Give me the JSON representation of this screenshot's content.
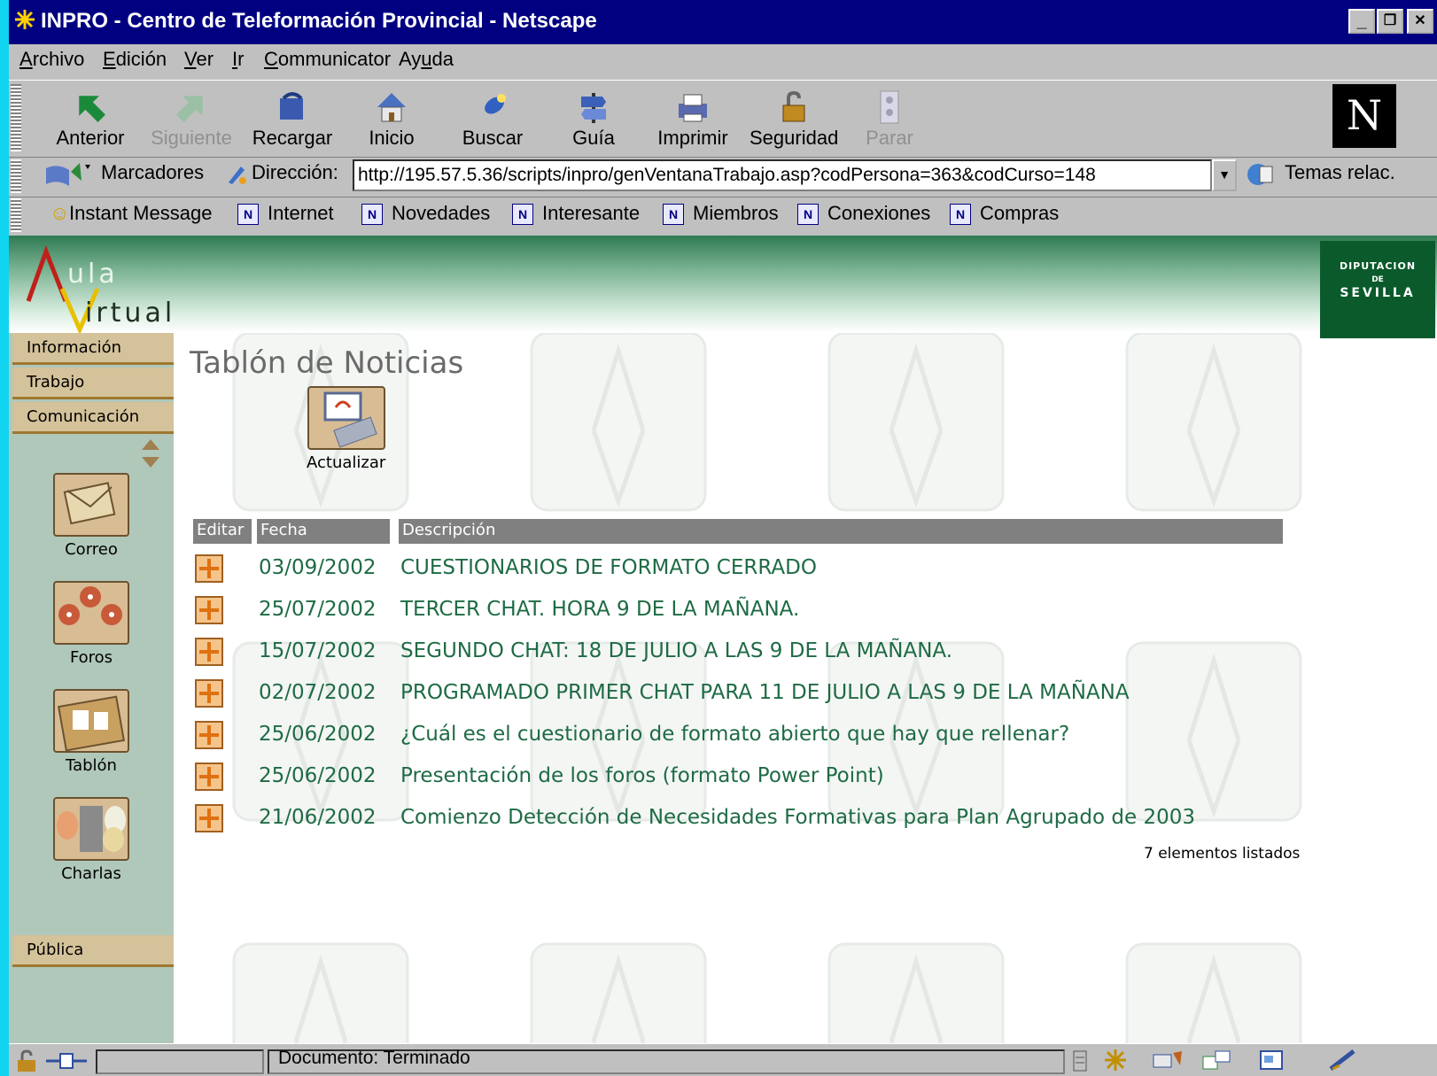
{
  "window": {
    "title": "INPRO - Centro de Teleformación Provincial - Netscape",
    "minimize": "_",
    "maximize": "❐",
    "close": "✕"
  },
  "menu": [
    {
      "first": "A",
      "rest": "rchivo"
    },
    {
      "first": "E",
      "rest": "dición"
    },
    {
      "first": "V",
      "rest": "er"
    },
    {
      "first": "I",
      "rest": "r"
    },
    {
      "first": "C",
      "rest": "ommunicator"
    },
    {
      "first": "Ay",
      "u": "u",
      "rest": "da"
    }
  ],
  "menu_labels": [
    "Archivo",
    "Edición",
    "Ver",
    "Ir",
    "Communicator",
    "Ayuda"
  ],
  "navigation": {
    "buttons": [
      "Anterior",
      "Siguiente",
      "Recargar",
      "Inicio",
      "Buscar",
      "Guía",
      "Imprimir",
      "Seguridad",
      "Parar"
    ]
  },
  "location": {
    "bookmarks_label": "Marcadores",
    "address_label": "Dirección:",
    "url": "http://195.57.5.36/scripts/inpro/genVentanaTrabajo.asp?codPersona=363&codCurso=148",
    "related_label": "Temas relac."
  },
  "personal_toolbar": [
    "Instant Message",
    "Internet",
    "Novedades",
    "Interesante",
    "Miembros",
    "Conexiones",
    "Compras"
  ],
  "banner": {
    "logo_line1": "ula",
    "logo_line2": "irtual",
    "dip_top": "DIPUTACION",
    "dip_mid": "DE",
    "dip_bottom": "SEVILLA"
  },
  "sidebar": {
    "tabs": [
      "Información",
      "Trabajo",
      "Comunicación"
    ],
    "items": [
      "Correo",
      "Foros",
      "Tablón",
      "Charlas"
    ],
    "bottom_tab": "Pública"
  },
  "main": {
    "title": "Tablón de Noticias",
    "refresh_label": "Actualizar",
    "columns": [
      "Editar",
      "Fecha",
      "Descripción"
    ],
    "rows": [
      {
        "date": "03/09/2002",
        "desc": "CUESTIONARIOS DE FORMATO CERRADO"
      },
      {
        "date": "25/07/2002",
        "desc": "TERCER CHAT. HORA 9 DE LA MAÑANA."
      },
      {
        "date": "15/07/2002",
        "desc": "SEGUNDO CHAT: 18 DE JULIO A LAS 9 DE LA MAÑANA."
      },
      {
        "date": "02/07/2002",
        "desc": "PROGRAMADO PRIMER CHAT PARA 11 DE JULIO A LAS 9 DE LA MAÑANA"
      },
      {
        "date": "25/06/2002",
        "desc": "¿Cuál es el cuestionario de formato abierto que hay que rellenar?"
      },
      {
        "date": "25/06/2002",
        "desc": "Presentación de los foros (formato Power Point)"
      },
      {
        "date": "21/06/2002",
        "desc": "Comienzo Detección de Necesidades Formativas para Plan Agrupado de 2003"
      }
    ],
    "count_text": "7 elementos listados"
  },
  "status": {
    "text": "Documento: Terminado"
  },
  "colors": {
    "title_bar": "#000080",
    "link_green": "#1e6b44",
    "banner_green": "#2f7a52",
    "sidebar_bg": "#b0c8ba",
    "tab_bg": "#d4c29a"
  }
}
